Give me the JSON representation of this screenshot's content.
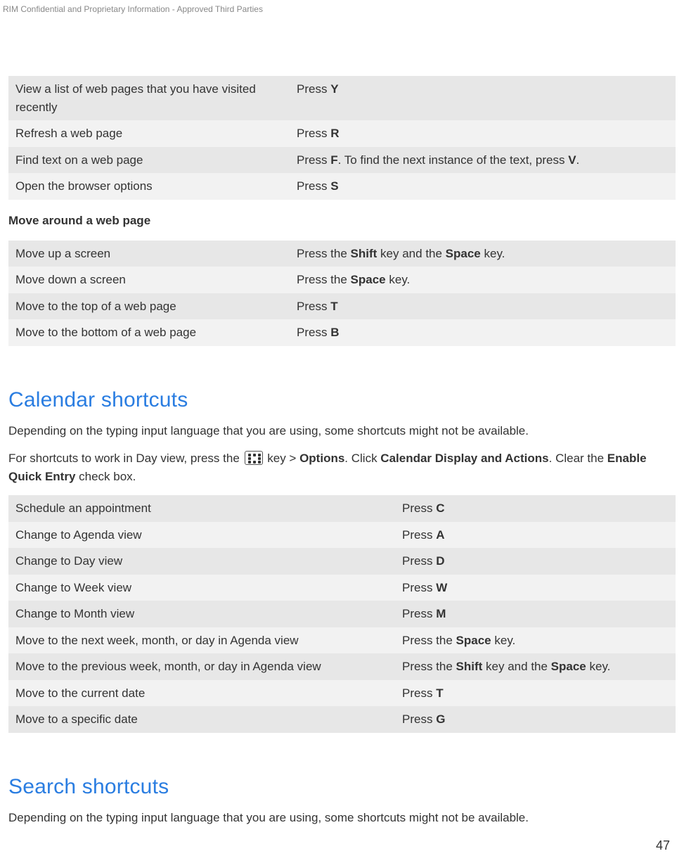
{
  "header": "RIM Confidential and Proprietary Information - Approved Third Parties",
  "page_number": "47",
  "table1": {
    "rows": [
      {
        "action": "View a list of web pages that you have visited recently",
        "key_pre": "Press ",
        "key_b1": "Y",
        "key_mid": "",
        "key_b2": "",
        "key_post": ""
      },
      {
        "action": "Refresh a web page",
        "key_pre": "Press ",
        "key_b1": "R",
        "key_mid": "",
        "key_b2": "",
        "key_post": ""
      },
      {
        "action": "Find text on a web page",
        "key_pre": "Press ",
        "key_b1": "F",
        "key_mid": ". To find the next instance of the text, press ",
        "key_b2": "V",
        "key_post": "."
      },
      {
        "action": "Open the browser options",
        "key_pre": "Press ",
        "key_b1": "S",
        "key_mid": "",
        "key_b2": "",
        "key_post": ""
      }
    ]
  },
  "sub1": "Move around a web page",
  "table2": {
    "rows": [
      {
        "action": "Move up a screen",
        "key_pre": "Press the ",
        "key_b1": "Shift",
        "key_mid": " key and the ",
        "key_b2": "Space",
        "key_post": " key."
      },
      {
        "action": "Move down a screen",
        "key_pre": "Press the ",
        "key_b1": "Space",
        "key_mid": " key.",
        "key_b2": "",
        "key_post": ""
      },
      {
        "action": "Move to the top of a web page",
        "key_pre": "Press ",
        "key_b1": "T",
        "key_mid": "",
        "key_b2": "",
        "key_post": ""
      },
      {
        "action": "Move to the bottom of a web page",
        "key_pre": "Press ",
        "key_b1": "B",
        "key_mid": "",
        "key_b2": "",
        "key_post": ""
      }
    ]
  },
  "heading_calendar": "Calendar shortcuts",
  "calendar_para1": "Depending on the typing input language that you are using, some shortcuts might not be available.",
  "calendar_para2": {
    "t1": "For shortcuts to work in Day view, press the ",
    "t2": " key > ",
    "b1": "Options",
    "t3": ". Click ",
    "b2": "Calendar Display and Actions",
    "t4": ". Clear the ",
    "b3": "Enable Quick Entry",
    "t5": " check box."
  },
  "table3": {
    "rows": [
      {
        "action": "Schedule an appointment",
        "key_pre": "Press ",
        "key_b1": "C",
        "key_mid": "",
        "key_b2": "",
        "key_post": ""
      },
      {
        "action": "Change to Agenda view",
        "key_pre": "Press ",
        "key_b1": "A",
        "key_mid": "",
        "key_b2": "",
        "key_post": ""
      },
      {
        "action": "Change to Day view",
        "key_pre": "Press ",
        "key_b1": "D",
        "key_mid": "",
        "key_b2": "",
        "key_post": ""
      },
      {
        "action": "Change to Week view",
        "key_pre": "Press ",
        "key_b1": "W",
        "key_mid": "",
        "key_b2": "",
        "key_post": ""
      },
      {
        "action": "Change to Month view",
        "key_pre": "Press ",
        "key_b1": "M",
        "key_mid": "",
        "key_b2": "",
        "key_post": ""
      },
      {
        "action": "Move to the next week, month, or day in Agenda view",
        "key_pre": "Press the ",
        "key_b1": "Space",
        "key_mid": " key.",
        "key_b2": "",
        "key_post": ""
      },
      {
        "action": "Move to the previous week, month, or day in Agenda view",
        "key_pre": "Press the ",
        "key_b1": "Shift",
        "key_mid": " key and the ",
        "key_b2": "Space",
        "key_post": " key."
      },
      {
        "action": "Move to the current date",
        "key_pre": "Press ",
        "key_b1": "T",
        "key_mid": "",
        "key_b2": "",
        "key_post": ""
      },
      {
        "action": "Move to a specific date",
        "key_pre": "Press ",
        "key_b1": "G",
        "key_mid": "",
        "key_b2": "",
        "key_post": ""
      }
    ]
  },
  "heading_search": "Search shortcuts",
  "search_para1": "Depending on the typing input language that you are using, some shortcuts might not be available."
}
